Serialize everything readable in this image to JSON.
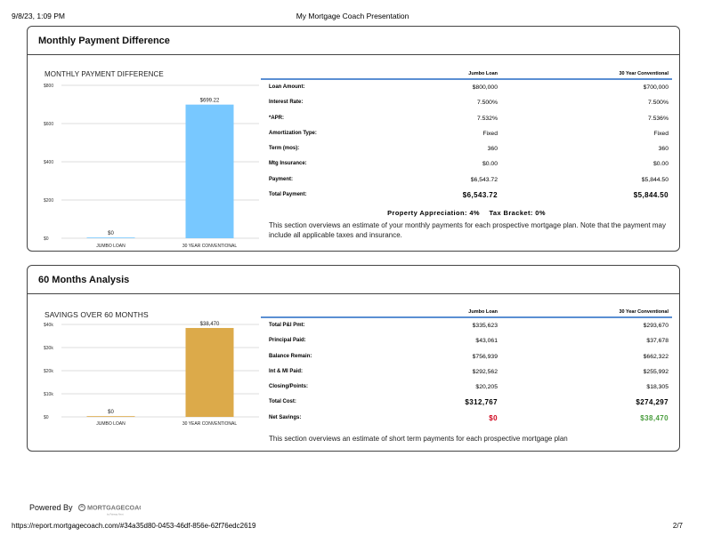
{
  "print_header": {
    "date": "9/8/23, 1:09 PM",
    "title": "My Mortgage Coach Presentation"
  },
  "section1": {
    "title": "Monthly Payment Difference",
    "chart_title": "MONTHLY PAYMENT DIFFERENCE",
    "columns": [
      "Jumbo Loan",
      "30 Year Conventional"
    ],
    "rows": [
      {
        "label": "Loan Amount:",
        "v1": "$800,000",
        "v2": "$700,000"
      },
      {
        "label": "Interest Rate:",
        "v1": "7.500%",
        "v2": "7.500%"
      },
      {
        "label": "*APR:",
        "v1": "7.532%",
        "v2": "7.536%"
      },
      {
        "label": "Amortization Type:",
        "v1": "Fixed",
        "v2": "Fixed"
      },
      {
        "label": "Term (mos):",
        "v1": "360",
        "v2": "360"
      },
      {
        "label": "Mtg Insurance:",
        "v1": "$0.00",
        "v2": "$0.00"
      },
      {
        "label": "Payment:",
        "v1": "$6,543.72",
        "v2": "$5,844.50"
      },
      {
        "label": "Total Payment:",
        "v1": "$6,543.72",
        "v2": "$5,844.50"
      }
    ],
    "appreciation": "Property Appreciation: 4%",
    "tax_bracket": "Tax Bracket: 0%",
    "description": "This section overviews an estimate of your monthly payments for each prospective mortgage plan. Note that the payment may include all applicable taxes and insurance."
  },
  "section2": {
    "title": "60 Months Analysis",
    "chart_title": "SAVINGS OVER 60 MONTHS",
    "columns": [
      "Jumbo Loan",
      "30 Year Conventional"
    ],
    "rows": [
      {
        "label": "Total P&I Pmt:",
        "v1": "$335,623",
        "v2": "$293,670"
      },
      {
        "label": "Principal Paid:",
        "v1": "$43,061",
        "v2": "$37,678"
      },
      {
        "label": "Balance Remain:",
        "v1": "$756,939",
        "v2": "$662,322"
      },
      {
        "label": "Int & MI Paid:",
        "v1": "$292,562",
        "v2": "$255,992"
      },
      {
        "label": "Closing/Points:",
        "v1": "$20,205",
        "v2": "$18,305"
      },
      {
        "label": "Total Cost:",
        "v1": "$312,767",
        "v2": "$274,297"
      },
      {
        "label": "Net Savings:",
        "v1": "$0",
        "v2": "$38,470"
      }
    ],
    "description": "This section overviews an estimate of short term payments for each prospective mortgage plan"
  },
  "chart_data": [
    {
      "type": "bar",
      "title": "MONTHLY PAYMENT DIFFERENCE",
      "categories": [
        "JUMBO LOAN",
        "30 YEAR CONVENTIONAL"
      ],
      "values": [
        0,
        699.22
      ],
      "value_labels": [
        "$0",
        "$699.22"
      ],
      "ylim": [
        0,
        800
      ],
      "yticks": [
        "$0",
        "$200",
        "$400",
        "$600",
        "$800"
      ],
      "tick_values": [
        0,
        200,
        400,
        600,
        800
      ],
      "bar_color": "#78c8ff",
      "grid": true
    },
    {
      "type": "bar",
      "title": "SAVINGS OVER 60 MONTHS",
      "categories": [
        "JUMBO LOAN",
        "30 YEAR CONVENTIONAL"
      ],
      "values": [
        0,
        38470
      ],
      "value_labels": [
        "$0",
        "$38,470"
      ],
      "ylim": [
        0,
        40000
      ],
      "yticks": [
        "$0",
        "$10k",
        "$20k",
        "$30k",
        "$40k"
      ],
      "tick_values": [
        0,
        10000,
        20000,
        30000,
        40000
      ],
      "bar_color": "#dcaa4a",
      "grid": true
    }
  ],
  "colors": {
    "net_savings_zero": "#d0021b",
    "net_savings_positive": "#4a9d3e",
    "table_rule": "#5b8fd3"
  },
  "footer": {
    "powered_by": "Powered By",
    "logo_text": "MORTGAGECOACH",
    "logo_subtext": "by Fairway Next",
    "url": "https://report.mortgagecoach.com/#34a35d80-0453-46df-856e-62f76edc2619",
    "page": "2/7"
  }
}
